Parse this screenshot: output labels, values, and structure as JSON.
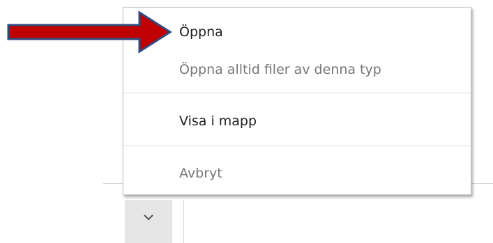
{
  "context_menu": {
    "items": [
      {
        "label": "Öppna",
        "enabled": true
      },
      {
        "label": "Öppna alltid filer av denna typ",
        "enabled": false
      },
      {
        "label": "Visa i mapp",
        "enabled": true
      },
      {
        "label": "Avbryt",
        "enabled": false
      }
    ]
  },
  "download_shelf": {
    "chevron_icon": "chevron-down-icon"
  },
  "annotation": {
    "arrow_icon": "red-arrow-icon",
    "arrow_color": "#c00000",
    "arrow_outline": "#2f4b7c"
  }
}
